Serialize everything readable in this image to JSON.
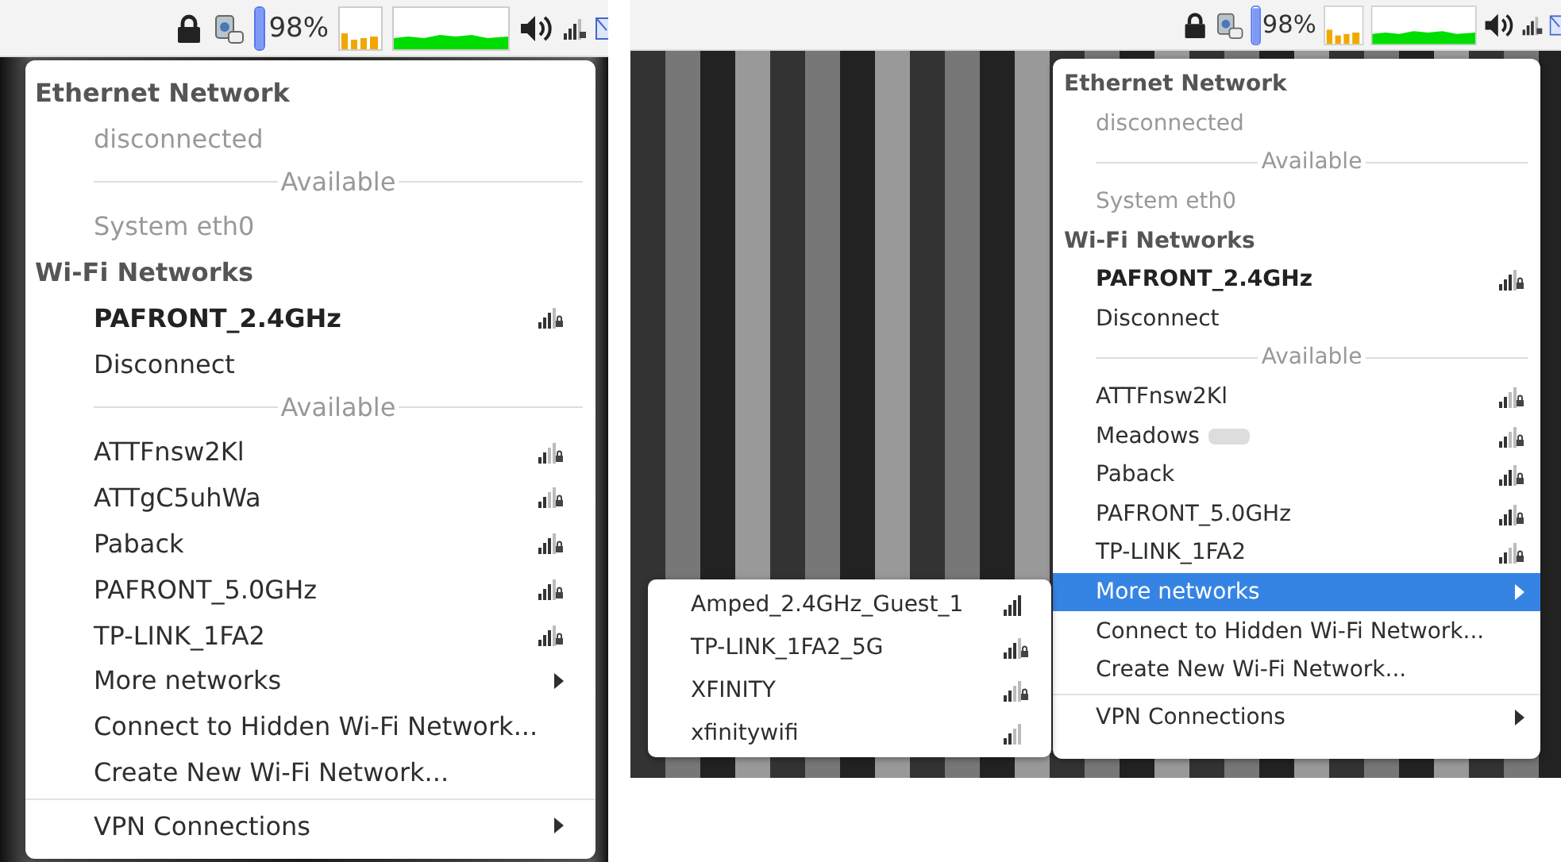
{
  "panels": [
    {
      "tray": {
        "battery": {
          "level": 0.98,
          "text": "98%"
        }
      },
      "menu": [
        {
          "kind": "header",
          "text": "Ethernet Network"
        },
        {
          "kind": "status",
          "text": "disconnected"
        },
        {
          "kind": "section",
          "text": "Available"
        },
        {
          "kind": "status",
          "text": "System eth0"
        },
        {
          "kind": "header",
          "text": "Wi-Fi Networks"
        },
        {
          "kind": "network",
          "text": "PAFRONT_2.4GHz",
          "active": true,
          "weak_signal": false,
          "full_signal": false,
          "secured": true
        },
        {
          "kind": "action",
          "text": "Disconnect"
        },
        {
          "kind": "section",
          "text": "Available"
        },
        {
          "kind": "network",
          "text": "ATTFnsw2Kl",
          "active": false,
          "weak_signal": true,
          "full_signal": false,
          "secured": true
        },
        {
          "kind": "network",
          "text": "ATTgC5uhWa",
          "active": false,
          "weak_signal": true,
          "full_signal": false,
          "secured": true
        },
        {
          "kind": "network",
          "text": "Paback",
          "active": false,
          "weak_signal": false,
          "full_signal": false,
          "secured": true
        },
        {
          "kind": "network",
          "text": "PAFRONT_5.0GHz",
          "active": false,
          "weak_signal": false,
          "full_signal": false,
          "secured": true
        },
        {
          "kind": "network",
          "text": "TP-LINK_1FA2",
          "active": false,
          "weak_signal": false,
          "full_signal": false,
          "secured": true
        },
        {
          "kind": "submenu",
          "text": "More networks",
          "selected": false
        },
        {
          "kind": "action",
          "text": "Connect to Hidden Wi-Fi Network..."
        },
        {
          "kind": "action",
          "text": "Create New Wi-Fi Network..."
        },
        {
          "kind": "divider"
        },
        {
          "kind": "submenu",
          "text": "VPN Connections",
          "selected": false
        }
      ]
    },
    {
      "tray": {
        "battery": {
          "level": 0.98,
          "text": "98%"
        }
      },
      "menu": [
        {
          "kind": "header",
          "text": "Ethernet Network"
        },
        {
          "kind": "status",
          "text": "disconnected"
        },
        {
          "kind": "section",
          "text": "Available"
        },
        {
          "kind": "status",
          "text": "System eth0"
        },
        {
          "kind": "header",
          "text": "Wi-Fi Networks"
        },
        {
          "kind": "network",
          "text": "PAFRONT_2.4GHz",
          "active": true,
          "weak_signal": false,
          "full_signal": false,
          "secured": true
        },
        {
          "kind": "action",
          "text": "Disconnect"
        },
        {
          "kind": "section",
          "text": "Available"
        },
        {
          "kind": "network",
          "text": "ATTFnsw2Kl",
          "active": false,
          "weak_signal": true,
          "full_signal": false,
          "secured": true
        },
        {
          "kind": "network",
          "text": "Meadows",
          "active": false,
          "weak_signal": true,
          "full_signal": false,
          "secured": true,
          "redacted": true
        },
        {
          "kind": "network",
          "text": "Paback",
          "active": false,
          "weak_signal": false,
          "full_signal": false,
          "secured": true
        },
        {
          "kind": "network",
          "text": "PAFRONT_5.0GHz",
          "active": false,
          "weak_signal": false,
          "full_signal": false,
          "secured": true
        },
        {
          "kind": "network",
          "text": "TP-LINK_1FA2",
          "active": false,
          "weak_signal": true,
          "full_signal": false,
          "secured": true
        },
        {
          "kind": "submenu",
          "text": "More networks",
          "selected": true
        },
        {
          "kind": "action",
          "text": "Connect to Hidden Wi-Fi Network..."
        },
        {
          "kind": "action",
          "text": "Create New Wi-Fi Network..."
        },
        {
          "kind": "divider"
        },
        {
          "kind": "submenu",
          "text": "VPN Connections",
          "selected": false
        }
      ],
      "submenu": [
        {
          "text": "Amped_2.4GHz_Guest_1",
          "weak_signal": false,
          "full_signal": true,
          "secured": false
        },
        {
          "text": "TP-LINK_1FA2_5G",
          "weak_signal": false,
          "full_signal": false,
          "secured": true
        },
        {
          "text": "XFINITY",
          "weak_signal": true,
          "full_signal": false,
          "secured": true
        },
        {
          "text": "xfinitywifi",
          "weak_signal": true,
          "full_signal": false,
          "secured": false
        }
      ]
    }
  ]
}
